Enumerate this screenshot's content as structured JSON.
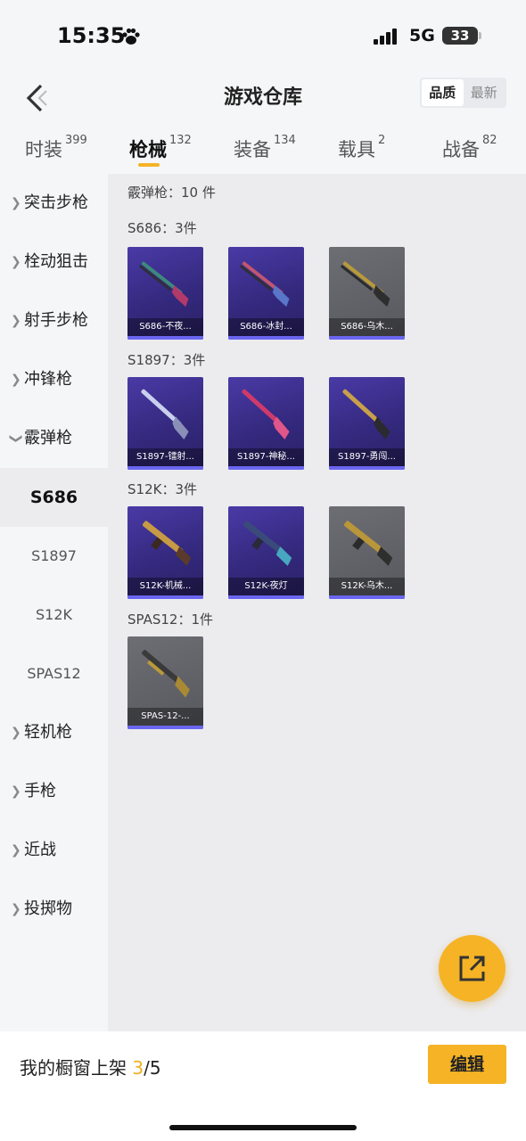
{
  "status_bar": {
    "time": "15:35",
    "network": "5G",
    "battery": "33"
  },
  "header": {
    "title": "游戏仓库",
    "sort": [
      "品质",
      "最新"
    ],
    "sort_active": "品质"
  },
  "tabs": [
    {
      "label": "时装",
      "count": "399"
    },
    {
      "label": "枪械",
      "count": "132"
    },
    {
      "label": "装备",
      "count": "134"
    },
    {
      "label": "载具",
      "count": "2"
    },
    {
      "label": "战备",
      "count": "82"
    }
  ],
  "active_tab": "枪械",
  "sidebar": {
    "categories": [
      "突击步枪",
      "栓动狙击",
      "射手步枪",
      "冲锋枪",
      "霰弹枪"
    ],
    "shotgun_subs": [
      "S686",
      "S1897",
      "S12K",
      "SPAS12"
    ],
    "active_sub": "S686",
    "more_categories": [
      "轻机枪",
      "手枪",
      "近战",
      "投掷物"
    ]
  },
  "main": {
    "section_title": "霰弹枪：10 件",
    "groups": [
      {
        "title": "S686：3件",
        "items": [
          {
            "name": "S686-不夜...",
            "rarity": "purple"
          },
          {
            "name": "S686-冰封...",
            "rarity": "purple"
          },
          {
            "name": "S686-乌木...",
            "rarity": "gray"
          }
        ]
      },
      {
        "title": "S1897：3件",
        "items": [
          {
            "name": "S1897-镭射...",
            "rarity": "purple"
          },
          {
            "name": "S1897-神秘...",
            "rarity": "purple"
          },
          {
            "name": "S1897-勇闯...",
            "rarity": "purple"
          }
        ]
      },
      {
        "title": "S12K：3件",
        "items": [
          {
            "name": "S12K-机械...",
            "rarity": "purple"
          },
          {
            "name": "S12K-夜灯",
            "rarity": "purple"
          },
          {
            "name": "S12K-乌木...",
            "rarity": "gray"
          }
        ]
      },
      {
        "title": "SPAS12：1件",
        "items": [
          {
            "name": "SPAS-12-...",
            "rarity": "gray"
          }
        ]
      }
    ]
  },
  "bottom": {
    "label": "我的橱窗上架 ",
    "current": "3",
    "total": "/5",
    "edit_label": "编辑"
  },
  "icons": {
    "back": "chevron-left-icon",
    "share": "share-icon",
    "paw": "paw-icon",
    "signal": "signal-icon"
  },
  "colors": {
    "accent": "#f5b325",
    "purple_card": "#3a2d8a",
    "gray_card": "#5f6066",
    "rarity_bar": "#6b66f0"
  }
}
